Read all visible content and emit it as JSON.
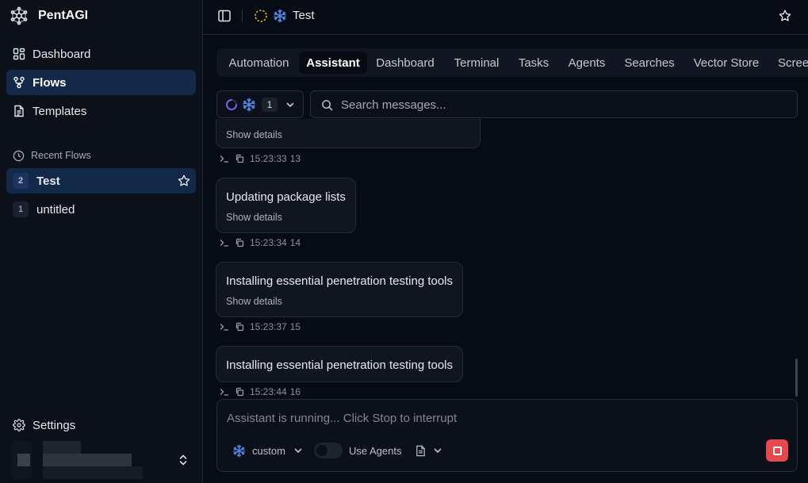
{
  "app": {
    "name": "PentAGI"
  },
  "sidebar": {
    "nav": [
      {
        "label": "Dashboard",
        "icon": "dashboard-grid-icon"
      },
      {
        "label": "Flows",
        "icon": "flows-icon",
        "active": true
      },
      {
        "label": "Templates",
        "icon": "templates-doc-icon"
      }
    ],
    "recent_label": "Recent Flows",
    "recent_flows": [
      {
        "num": "2",
        "name": "Test",
        "active": true
      },
      {
        "num": "1",
        "name": "untitled"
      }
    ],
    "settings_label": "Settings"
  },
  "header": {
    "title": "Test"
  },
  "tabs": [
    {
      "label": "Automation"
    },
    {
      "label": "Assistant",
      "active": true
    },
    {
      "label": "Dashboard"
    },
    {
      "label": "Terminal"
    },
    {
      "label": "Tasks"
    },
    {
      "label": "Agents"
    },
    {
      "label": "Searches"
    },
    {
      "label": "Vector Store"
    },
    {
      "label": "Screenshots"
    }
  ],
  "filters": {
    "agent_count": "1",
    "search_placeholder": "Search messages..."
  },
  "messages": [
    {
      "text": "",
      "details": "Show details",
      "time": "15:23:33",
      "id": "13"
    },
    {
      "text": "Updating package lists",
      "details": "Show details",
      "time": "15:23:34",
      "id": "14"
    },
    {
      "text": "Installing essential penetration testing tools",
      "details": "Show details",
      "time": "15:23:37",
      "id": "15"
    },
    {
      "text": "Installing essential penetration testing tools",
      "time": "15:23:44",
      "id": "16"
    }
  ],
  "composer": {
    "placeholder": "Assistant is running... Click Stop to interrupt",
    "model": "custom",
    "use_agents_label": "Use Agents",
    "use_agents_on": false
  },
  "colors": {
    "background": "#070b13",
    "sidebar": "#0b1019",
    "active_nav": "#13294a",
    "accent_blue": "#4f86e8",
    "spinner_purple": "#7b5cf0",
    "status_yellow": "#e3b233",
    "stop_red": "#e5484d"
  }
}
